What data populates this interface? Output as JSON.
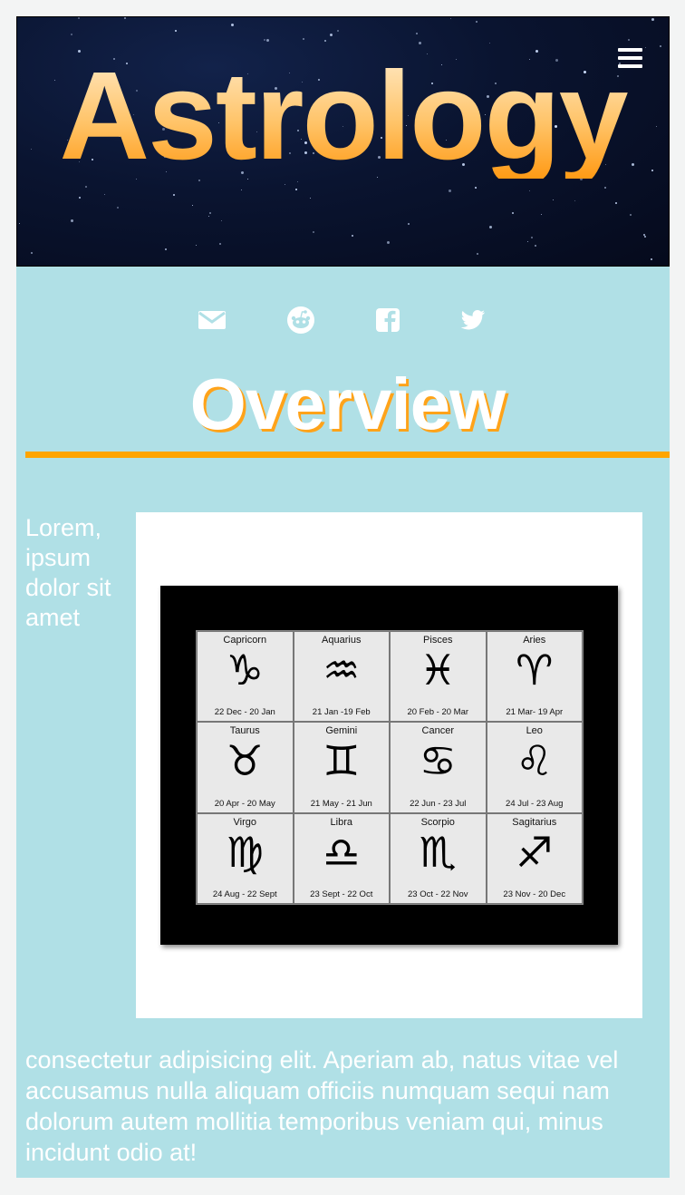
{
  "header": {
    "title": "Astrology",
    "menu_icon": "hamburger-menu-icon"
  },
  "social": [
    {
      "name": "email-icon",
      "glyph": "envelope"
    },
    {
      "name": "reddit-icon",
      "glyph": "reddit"
    },
    {
      "name": "facebook-icon",
      "glyph": "facebook"
    },
    {
      "name": "twitter-icon",
      "glyph": "twitter"
    }
  ],
  "section": {
    "heading": "Overview",
    "side_text": "Lorem, ipsum dolor sit amet",
    "body_text": "consectetur adipisicing elit. Aperiam ab, natus vitae vel accusamus nulla aliquam officiis numquam sequi nam dolorum autem mollitia temporibus veniam qui, minus incidunt odio at!"
  },
  "zodiac": [
    {
      "name": "Capricorn",
      "symbol": "♑",
      "dates": "22 Dec - 20 Jan"
    },
    {
      "name": "Aquarius",
      "symbol": "♒",
      "dates": "21 Jan -19 Feb"
    },
    {
      "name": "Pisces",
      "symbol": "♓",
      "dates": "20 Feb - 20 Mar"
    },
    {
      "name": "Aries",
      "symbol": "♈",
      "dates": "21 Mar- 19 Apr"
    },
    {
      "name": "Taurus",
      "symbol": "♉",
      "dates": "20 Apr - 20 May"
    },
    {
      "name": "Gemini",
      "symbol": "♊",
      "dates": "21 May - 21 Jun"
    },
    {
      "name": "Cancer",
      "symbol": "♋",
      "dates": "22 Jun - 23 Jul"
    },
    {
      "name": "Leo",
      "symbol": "♌",
      "dates": "24 Jul - 23 Aug"
    },
    {
      "name": "Virgo",
      "symbol": "♍",
      "dates": "24 Aug - 22 Sept"
    },
    {
      "name": "Libra",
      "symbol": "♎",
      "dates": "23 Sept - 22 Oct"
    },
    {
      "name": "Scorpio",
      "symbol": "♏",
      "dates": "23 Oct - 22 Nov"
    },
    {
      "name": "Sagitarius",
      "symbol": "♐",
      "dates": "23 Nov - 20 Dec"
    }
  ],
  "colors": {
    "content_bg": "#b0e0e6",
    "accent": "#ffa500",
    "header_bg": "#0a1430"
  }
}
